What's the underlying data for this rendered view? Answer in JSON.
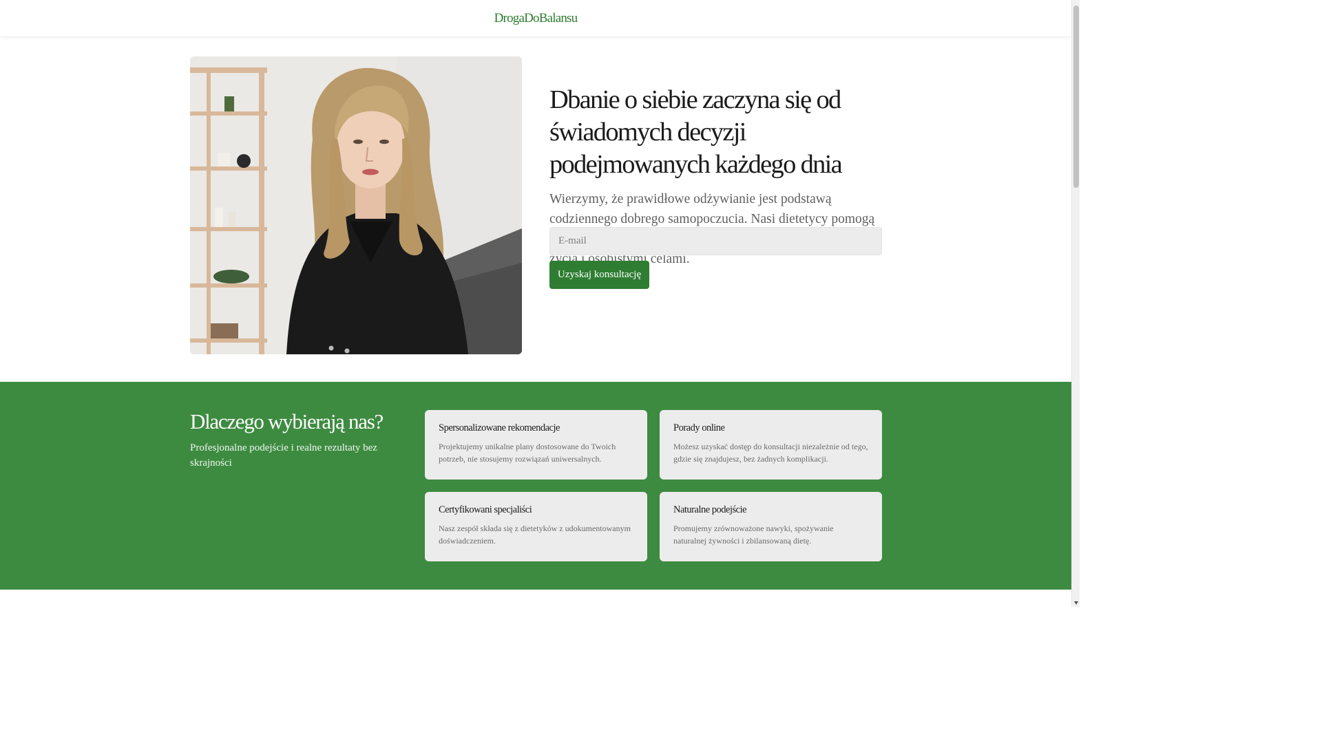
{
  "header": {
    "logo": "DrogaDoBalansu"
  },
  "hero": {
    "title": "Dbanie o siebie zaczyna się od świadomych decyzji podejmowanych każdego dnia",
    "subtitle": "Wierzymy, że prawidłowe odżywianie jest podstawą codziennego dobrego samopoczucia. Nasi dietetycy pomogą Ci znaleźć idealną równowagę między nawykami, stylem życia i osobistymi celami.",
    "email_placeholder": "E-mail",
    "email_value": "",
    "cta_label": "Uzyskaj konsultację"
  },
  "why": {
    "title": "Dlaczego wybierają nas?",
    "subtitle": "Profesjonalne podejście i realne rezultaty bez skrajności",
    "cards": [
      {
        "title": "Spersonalizowane rekomendacje",
        "desc": "Projektujemy unikalne plany dostosowane do Twoich potrzeb, nie stosujemy rozwiązań uniwersalnych."
      },
      {
        "title": "Porady online",
        "desc": "Możesz uzyskać dostęp do konsultacji niezależnie od tego, gdzie się znajdujesz, bez żadnych komplikacji."
      },
      {
        "title": "Certyfikowani specjaliści",
        "desc": "Nasz zespół składa się z dietetyków z udokumentowanym doświadczeniem."
      },
      {
        "title": "Naturalne podejście",
        "desc": "Promujemy zrównoważone nawyki, spożywanie naturalnej żywności i zbilansowaną dietę."
      }
    ]
  },
  "colors": {
    "brand_green": "#2e7d32",
    "section_green": "#3d8b40",
    "card_bg": "#ececec"
  }
}
